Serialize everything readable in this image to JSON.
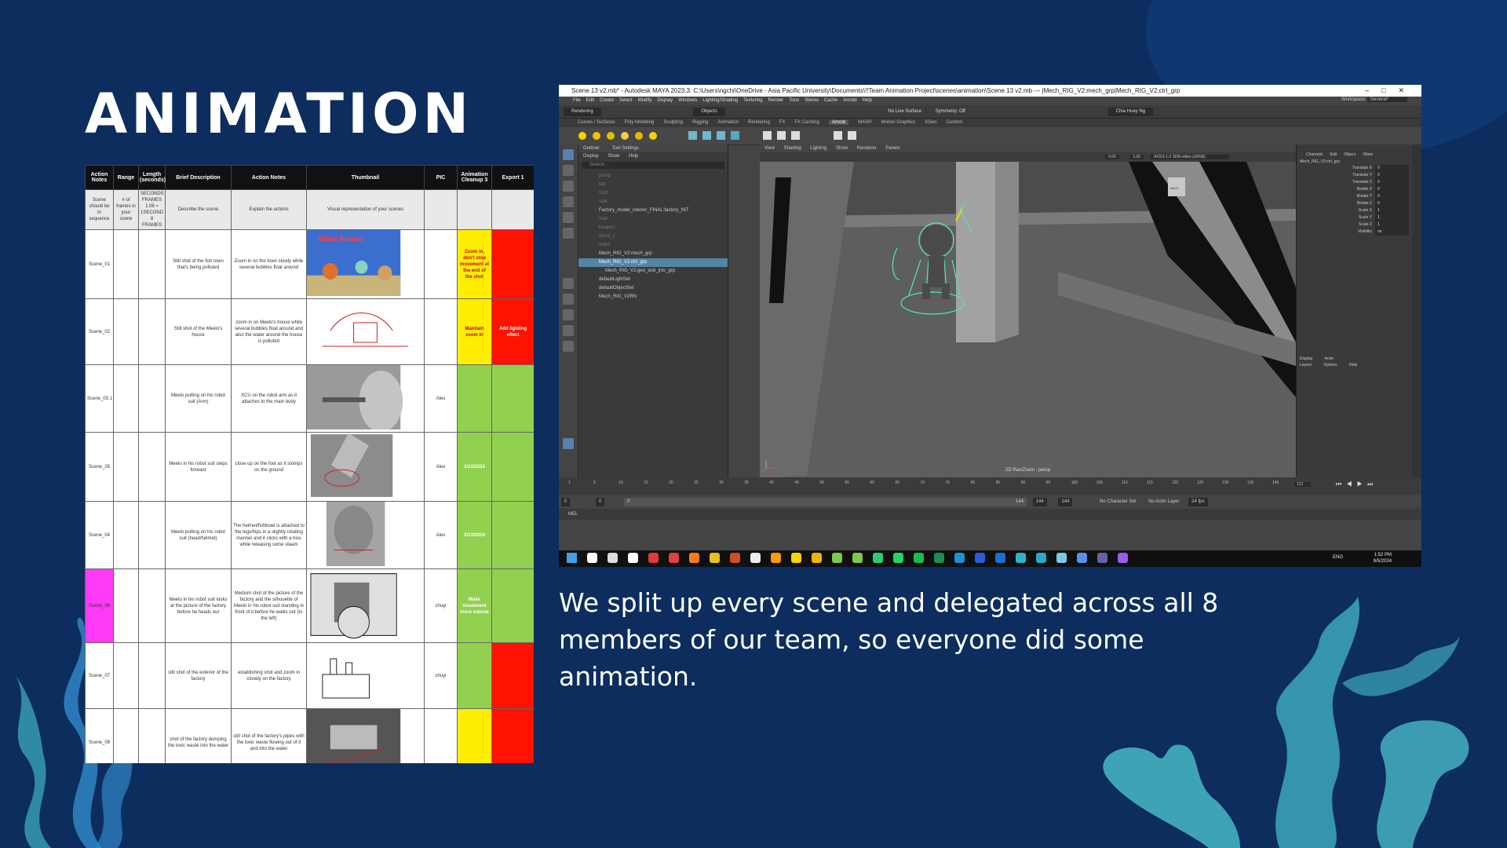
{
  "slide": {
    "title": "ANIMATION",
    "caption": "We split up every scene and delegated across all 8 members of our team, so everyone did some animation.",
    "background_color": "#0c2d5e",
    "seaweed_colors": [
      "#2f86c6",
      "#3aa0b8",
      "#49b8c6"
    ]
  },
  "sheet": {
    "headers": [
      "Action Notes",
      "Range",
      "Length (seconds)",
      "Brief Description",
      "Action Notes",
      "Thumbnail",
      "PIC",
      "Animation Cleanup 3",
      "Export 1"
    ],
    "subheader": [
      "Scene should be in sequence",
      "# of frames in your scene",
      "SECONDS FRAMES 1.08 = 1SECOND 8 FRAMES",
      "Describe the scene",
      "Explain the actions",
      "Visual representation of your scenes",
      "",
      "",
      ""
    ],
    "rows": [
      {
        "scene": "Scene_01",
        "brief": "Still shot of the fish town that's being polluted",
        "action": "Zoom in on the town slowly while several bubbles float around",
        "pic": "",
        "cleanup": "Zoom in, don't stop movement at the end of the shot",
        "cleanup_color": "yellow",
        "export": "",
        "export_color": "red",
        "scene_color": "",
        "thumb_label": "Bikini Bottom"
      },
      {
        "scene": "Scene_02",
        "brief": "Still shot of the Meelo's house",
        "action": "zoom in on Meelo's house while several bubbles float around and also the water around the house is polluted",
        "pic": "",
        "cleanup": "Maintain zoom in",
        "cleanup_color": "yellow",
        "export": "Add lighting effect",
        "export_color": "red",
        "scene_color": "",
        "thumb_label": ""
      },
      {
        "scene": "Scene_03.1",
        "brief": "Meelo putting on his robot suit (Arm)",
        "action": "XCU on the robot arm as it attaches to the main body",
        "pic": "Alex",
        "cleanup": "",
        "cleanup_color": "green",
        "export": "",
        "export_color": "green",
        "scene_color": "",
        "thumb_label": ""
      },
      {
        "scene": "Scene_05",
        "brief": "Meelo in his robot suit steps forward",
        "action": "close up on the foot as it stomps on the ground",
        "pic": "Alex",
        "cleanup": "3/13/2024",
        "cleanup_color": "green",
        "export": "",
        "export_color": "green",
        "scene_color": "",
        "thumb_label": ""
      },
      {
        "scene": "Scene_04",
        "brief": "Meelo putting on his robot suit (head/helmet)",
        "action": "The helmet/fishbowl is attached to the legs/hips in a slightly rotating manner and it clicks with a hiss while releasing some steam",
        "pic": "Alex",
        "cleanup": "3/13/2024",
        "cleanup_color": "green",
        "export": "",
        "export_color": "green",
        "scene_color": "",
        "thumb_label": ""
      },
      {
        "scene": "Scene_06",
        "brief": "Meelo in his robot suit looks at the picture of the factory before he heads out",
        "action": "Medium shot of the picture of the factory and the silhouette of Meelo in his robot suit standing in front of it before he walks out (to the left)",
        "pic": "chuyi",
        "cleanup": "Make movement more natural",
        "cleanup_color": "green",
        "export": "",
        "export_color": "green",
        "scene_color": "magenta",
        "thumb_label": ""
      },
      {
        "scene": "Scene_07",
        "brief": "still shot of the exterior of the factory",
        "action": "establishing shot and zoom in closely on the factory",
        "pic": "chuyi",
        "cleanup": "",
        "cleanup_color": "green",
        "export": "",
        "export_color": "red",
        "scene_color": "",
        "thumb_label": ""
      },
      {
        "scene": "Scene_08",
        "brief": "shot of the factory dumping the toxic waste into the water",
        "action": "still shot of the factory's pipes with the toxic waste flowing out of it and into the water",
        "pic": "",
        "cleanup": "",
        "cleanup_color": "yellow",
        "export": "",
        "export_color": "red",
        "scene_color": "",
        "thumb_label": ""
      }
    ]
  },
  "maya": {
    "title": "Scene 13 v2.mb* - Autodesk MAYA 2023.3: C:\\Users\\ngchi\\OneDrive - Asia Pacific University\\Documents\\!!Team Animation Project\\scenes\\animation\\Scene 13 v2.mb  ---  |Mech_RIG_V2:mech_grp|Mech_RIG_V2:ctrl_grp",
    "window_controls": "–□✕",
    "menus": [
      "File",
      "Edit",
      "Create",
      "Select",
      "Modify",
      "Display",
      "Windows",
      "Lighting/Shading",
      "Texturing",
      "Render",
      "Toon",
      "Stereo",
      "Cache",
      "Arnold",
      "Help"
    ],
    "workspace_label": "Workspace:",
    "workspace_value": "General*",
    "menuset": "Rendering",
    "objects_label": "Objects",
    "surface_label": "No Live Surface",
    "symmetry_label": "Symmetry: Off",
    "user": "Chia Huey Ng",
    "shelf_tabs": [
      "Curves / Surfaces",
      "Poly Modeling",
      "Sculpting",
      "Rigging",
      "Animation",
      "Rendering",
      "FX",
      "FX Caching",
      "Arnold",
      "MASH",
      "Motion Graphics",
      "XGen",
      "Custom"
    ],
    "active_shelf": "Arnold",
    "outliner": {
      "tabs": [
        "Outliner",
        "Tool Settings"
      ],
      "menu": [
        "Display",
        "Show",
        "Help"
      ],
      "search_placeholder": "Search...",
      "items": [
        {
          "label": "persp",
          "state": "dim"
        },
        {
          "label": "top",
          "state": "dim"
        },
        {
          "label": "front",
          "state": "dim"
        },
        {
          "label": "side",
          "state": "dim"
        },
        {
          "label": "Factory_model_interior_FINAL:factory_INT",
          "state": ""
        },
        {
          "label": "stair",
          "state": "dim"
        },
        {
          "label": "locator1",
          "state": "dim"
        },
        {
          "label": "fence_1",
          "state": "dim"
        },
        {
          "label": "stair2",
          "state": "dim"
        },
        {
          "label": "Mech_RIG_V2:mech_grp",
          "state": ""
        },
        {
          "label": "Mech_RIG_V2:ctrl_grp",
          "state": "sel"
        },
        {
          "label": "Mech_RIG_V2:geo_and_jnts_grp",
          "state": "ind"
        },
        {
          "label": "defaultLightSet",
          "state": ""
        },
        {
          "label": "defaultObjectSet",
          "state": ""
        },
        {
          "label": "Mech_RIG_V2RN",
          "state": ""
        }
      ]
    },
    "viewport": {
      "menus": [
        "View",
        "Shading",
        "Lighting",
        "Show",
        "Renderer",
        "Panels"
      ],
      "gamma_a": "0.00",
      "gamma_b": "1.00",
      "colorspace": "ACES 1.0 SDR-video (sRGB)",
      "camera_label": "2D Pan/Zoom : persp",
      "cube_label": "BACK"
    },
    "channel_box": {
      "menu": [
        "Channels",
        "Edit",
        "Object",
        "Show"
      ],
      "object": "Mech_RIG_V2:ctrl_grp",
      "channels": [
        {
          "name": "Translate X",
          "value": "0"
        },
        {
          "name": "Translate Y",
          "value": "0"
        },
        {
          "name": "Translate Z",
          "value": "0"
        },
        {
          "name": "Rotate X",
          "value": "0"
        },
        {
          "name": "Rotate Y",
          "value": "0"
        },
        {
          "name": "Rotate Z",
          "value": "0"
        },
        {
          "name": "Scale X",
          "value": "1"
        },
        {
          "name": "Scale Y",
          "value": "1"
        },
        {
          "name": "Scale Z",
          "value": "1"
        },
        {
          "name": "Visibility",
          "value": "on"
        }
      ],
      "layer_tabs": [
        "Display",
        "Anim"
      ],
      "layer_menu": [
        "Layers",
        "Options",
        "Help"
      ]
    },
    "timeline": {
      "ticks": [
        "1",
        "5",
        "10",
        "15",
        "20",
        "25",
        "30",
        "35",
        "40",
        "45",
        "50",
        "55",
        "60",
        "65",
        "70",
        "75",
        "80",
        "85",
        "90",
        "95",
        "100",
        "105",
        "110",
        "115",
        "120",
        "125",
        "130",
        "135",
        "140"
      ],
      "current_frame": "123",
      "start": "0",
      "start_inner": "0",
      "range_start": "0",
      "range_end": "144",
      "end_inner": "144",
      "end": "144",
      "character_set": "No Character Set",
      "anim_layer": "No Anim Layer",
      "fps": "24 fps"
    },
    "mel_label": "MEL",
    "taskbar": {
      "app_colors": [
        "#3da0e8",
        "#ffffff",
        "#dddddd",
        "#ffffff",
        "#e03a3a",
        "#e04040",
        "#ff7a18",
        "#e8c21a",
        "#d04e22",
        "#eeeeee",
        "#ff9a00",
        "#f5d400",
        "#f0b400",
        "#7cc94a",
        "#7cc94a",
        "#2ecc71",
        "#25d366",
        "#1db954",
        "#1d8f4e",
        "#1f8fd8",
        "#2a5bd7",
        "#1c6ed8",
        "#28b6c8",
        "#2aa8c8",
        "#7dc8e8",
        "#5c8df0",
        "#6264a7",
        "#9b5cf0"
      ],
      "lang": "ENG",
      "time": "1:52 PM",
      "date": "9/5/2024"
    }
  }
}
